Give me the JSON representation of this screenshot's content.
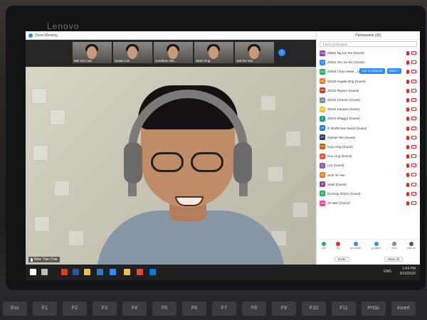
{
  "device": {
    "brand": "Lenovo"
  },
  "window": {
    "title": "Zoom Meeting"
  },
  "thumbnails": [
    {
      "name": "Mei Xiu Low"
    },
    {
      "name": "Susan Lim"
    },
    {
      "name": "Jonathan We..."
    },
    {
      "name": "Sean Ong"
    },
    {
      "name": "Sek Ee Yeo"
    }
  ],
  "speaker": {
    "name": "Wee Tian Chia"
  },
  "participants_panel": {
    "title": "Participants (36)",
    "find_placeholder": "Find a participant",
    "unmute_label": "Ask to Unmute",
    "more_label": "More >",
    "items": [
      {
        "initials": "CN",
        "name": "20921 Ng Lai Yee (Guest)",
        "color": "#8e44ad"
      },
      {
        "initials": "TJ",
        "name": "20921 Teo Jia Xin (Guest)",
        "color": "#2d8cff"
      },
      {
        "initials": "CH",
        "name": "20404 Chua Hwee... (Guest)",
        "color": "#27ae60"
      },
      {
        "initials": "AC",
        "name": "20425 Angela Ong (Guest)",
        "color": "#e67e22"
      },
      {
        "initials": "DR",
        "name": "20431 Rayner (Guest)",
        "color": "#c0392b"
      },
      {
        "initials": "CE",
        "name": "20431 Chia En (Guest)",
        "color": "#7f8c8d"
      },
      {
        "initials": "KE",
        "name": "20431 Kenyan (Guest)",
        "color": "#f1c40f"
      },
      {
        "initials": "Z",
        "name": "20431 Zhiggyz (Guest)",
        "color": "#16a085"
      },
      {
        "initials": "AS",
        "name": "R 20405 Dee Seyid (Guest)",
        "color": "#2980b9"
      },
      {
        "initials": "GT",
        "name": "Gabriel Teh (Guest)",
        "color": "#2c3e50"
      },
      {
        "initials": "GO",
        "name": "Gary Ong (Guest)",
        "color": "#d35400"
      },
      {
        "initials": "GL",
        "name": "Guo Ling (Guest)",
        "color": "#e74c3c"
      },
      {
        "initials": "L",
        "name": "Lim (Guest)",
        "color": "#9b59b6"
      },
      {
        "initials": "SY",
        "name": "Sroh Ye Yee",
        "color": "#e67e22"
      },
      {
        "initials": "S",
        "name": "Seah (Guest)",
        "color": "#8e44ad"
      },
      {
        "initials": "SZ",
        "name": "Sunning 20421 (Guest)",
        "color": "#27ae60"
      },
      {
        "initials": "YW",
        "name": "Ye Wen (Guest)",
        "color": "#e84393"
      }
    ],
    "reactions": [
      {
        "label": "yes",
        "color": "#27ae60"
      },
      {
        "label": "no",
        "color": "#e02828"
      },
      {
        "label": "go slower",
        "color": "#2d8cff"
      },
      {
        "label": "go faster",
        "color": "#2d8cff"
      },
      {
        "label": "more",
        "color": "#888888"
      },
      {
        "label": "clear all",
        "color": "#555555"
      }
    ],
    "invite_label": "Invite",
    "mute_all_label": "Mute All"
  },
  "taskbar": {
    "language": "ENG",
    "time": "1:04 PM",
    "date": "9/10/2020"
  },
  "keyboard": {
    "keys": [
      "Esc",
      "F1",
      "F2",
      "F3",
      "F4",
      "F5",
      "F6",
      "F7",
      "F8",
      "F9",
      "F10",
      "F11",
      "PrtSc",
      "Insert"
    ]
  }
}
